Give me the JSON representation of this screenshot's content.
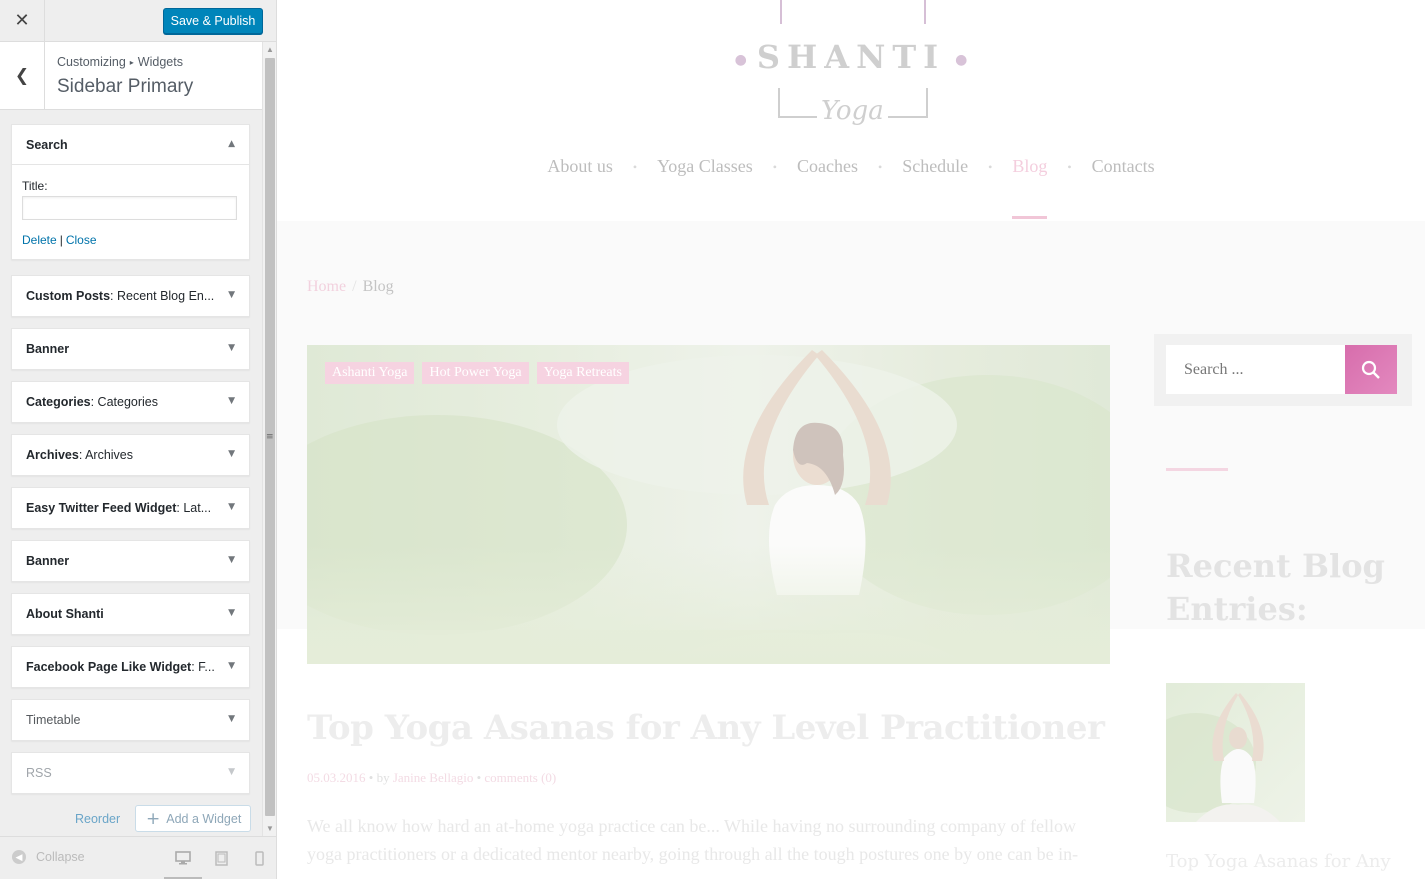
{
  "customizer": {
    "close_icon": "close-icon",
    "save_label": "Save & Publish",
    "breadcrumb_root": "Customizing",
    "breadcrumb_child": "Widgets",
    "section_title": "Sidebar Primary",
    "widgets": [
      {
        "name": "Search",
        "subtitle": "",
        "open": true
      },
      {
        "name": "Custom Posts",
        "subtitle": ": Recent Blog En..."
      },
      {
        "name": "Banner",
        "subtitle": ""
      },
      {
        "name": "Categories",
        "subtitle": ": Categories"
      },
      {
        "name": "Archives",
        "subtitle": ": Archives"
      },
      {
        "name": "Easy Twitter Feed Widget",
        "subtitle": ": Lat..."
      },
      {
        "name": "Banner",
        "subtitle": ""
      },
      {
        "name": "About Shanti",
        "subtitle": ""
      },
      {
        "name": "Facebook Page Like Widget",
        "subtitle": ": F..."
      },
      {
        "name": "Timetable",
        "subtitle": ""
      },
      {
        "name": "RSS",
        "subtitle": ""
      }
    ],
    "search_widget": {
      "title_label": "Title:",
      "title_value": "",
      "delete_label": "Delete",
      "close_label": "Close"
    },
    "reorder_label": "Reorder",
    "add_widget_label": "Add a Widget",
    "collapse_label": "Collapse"
  },
  "preview": {
    "logo_text": "SHANTI",
    "logo_script": "Yoga",
    "nav": [
      "About us",
      "Yoga Classes",
      "Coaches",
      "Schedule",
      "Blog",
      "Contacts"
    ],
    "nav_active": "Blog",
    "breadcrumb_home": "Home",
    "breadcrumb_current": "Blog",
    "tags": [
      "Ashanti Yoga",
      "Hot Power Yoga",
      "Yoga Retreats"
    ],
    "post_title": "Top Yoga Asanas for Any Level Practitioner",
    "post_date": "05.03.2016",
    "post_by": "by",
    "post_author": "Janine Bellagio",
    "post_comments": "comments (0)",
    "post_excerpt": "We all know how hard an at-home yoga practice can be... While having no surrounding company of fellow yoga practitioners or a dedicated mentor nearby, going through all the tough postures one by one can be in-",
    "search_placeholder": "Search ...",
    "recent_title": "Recent Blog Entries:",
    "recent_post_title": "Top Yoga Asanas for Any"
  },
  "colors": {
    "primary_button": "#0085ba",
    "link": "#0073aa",
    "accent_pink": "#e389bf"
  }
}
